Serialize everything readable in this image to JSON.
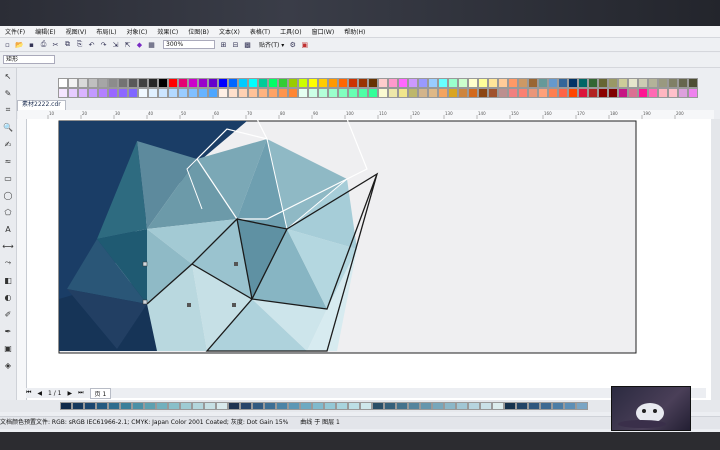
{
  "menu": [
    "文件(F)",
    "编辑(E)",
    "视图(V)",
    "布局(L)",
    "对象(C)",
    "效果(C)",
    "位图(B)",
    "文本(X)",
    "表格(T)",
    "工具(O)",
    "窗口(W)",
    "帮助(H)"
  ],
  "toolbar": {
    "zoom_value": "300%",
    "snap_label": "贴齐(T) ▾"
  },
  "property_bar": {
    "preset": "矩形"
  },
  "document_tab": {
    "label": "素材2222.cdr"
  },
  "ruler": {
    "marks": [
      "10",
      "20",
      "30",
      "40",
      "50",
      "60",
      "70",
      "80",
      "90",
      "100",
      "110",
      "120",
      "130",
      "140",
      "150",
      "160",
      "170",
      "180",
      "190",
      "200"
    ]
  },
  "page_bar": {
    "page_counter": "1 / 1",
    "page_tab": "页 1"
  },
  "status": {
    "text": "文档颜色预置文件: RGB: sRGB IEC61966-2.1; CMYK: Japan Color 2001 Coated; 灰度: Dot Gain 15%",
    "object_info": "曲线 于 图层 1"
  },
  "colors": {
    "palette": [
      "#ffffff",
      "#f2f2f2",
      "#d9d9d9",
      "#bfbfbf",
      "#a6a6a6",
      "#8c8c8c",
      "#737373",
      "#595959",
      "#404040",
      "#262626",
      "#000000",
      "#ff0000",
      "#e60073",
      "#cc00cc",
      "#9900cc",
      "#6600cc",
      "#0000ff",
      "#0066ff",
      "#00ccff",
      "#00ffff",
      "#00cc99",
      "#00ff66",
      "#33cc33",
      "#99cc00",
      "#ccff00",
      "#ffff00",
      "#ffcc00",
      "#ff9900",
      "#ff6600",
      "#cc3300",
      "#993300",
      "#663300",
      "#ffcccc",
      "#ff99cc",
      "#ff66ff",
      "#cc99ff",
      "#9999ff",
      "#99ccff",
      "#66ffff",
      "#99ffcc",
      "#ccffcc",
      "#ffffcc",
      "#ffff99",
      "#ffe699",
      "#ffcc99",
      "#ff9966",
      "#cc9966",
      "#996633",
      "#669999",
      "#6699cc",
      "#336699",
      "#003366",
      "#006666",
      "#336633",
      "#666633",
      "#999966",
      "#cccc99",
      "#e6e6cc",
      "#ccccb3",
      "#b3b399",
      "#999980",
      "#808066",
      "#66664d",
      "#4d4d33",
      "#f5e6ff",
      "#e6ccff",
      "#d9b3ff",
      "#c299ff",
      "#b380ff",
      "#9966ff",
      "#8c66ff",
      "#7f66ff",
      "#f0f8ff",
      "#e0f0ff",
      "#cce5ff",
      "#b3d9ff",
      "#99ccff",
      "#80bfff",
      "#66b3ff",
      "#4da6ff",
      "#fff0e6",
      "#ffe0cc",
      "#ffd1b3",
      "#ffc299",
      "#ffb380",
      "#ffa366",
      "#ff944d",
      "#ff8533",
      "#e6fff2",
      "#ccffe6",
      "#b3ffd9",
      "#99ffcc",
      "#80ffbf",
      "#66ffb3",
      "#4dffa6",
      "#33ff99",
      "#fafad2",
      "#eee8aa",
      "#f0e68c",
      "#bdb76b",
      "#d2b48c",
      "#deb887",
      "#f4a460",
      "#daa520",
      "#cd853f",
      "#d2691e",
      "#8b4513",
      "#a0522d",
      "#bc8f8f",
      "#f08080",
      "#fa8072",
      "#e9967a",
      "#ffa07a",
      "#ff7f50",
      "#ff6347",
      "#ff4500",
      "#dc143c",
      "#b22222",
      "#8b0000",
      "#800000",
      "#c71585",
      "#db7093",
      "#ff1493",
      "#ff69b4",
      "#ffb6c1",
      "#ffc0cb",
      "#dda0dd",
      "#ee82ee"
    ],
    "bottom_palette": [
      "#0f2a4a",
      "#15385c",
      "#1b466e",
      "#245a80",
      "#2e6d8e",
      "#3a7f9a",
      "#4b90a6",
      "#5ea0b0",
      "#72b0bd",
      "#88bfc9",
      "#9ecbd3",
      "#b3d6dc",
      "#c7e0e4",
      "#d8e9ec",
      "#1e3350",
      "#28456a",
      "#325a80",
      "#3e6f94",
      "#4c84a6",
      "#5c97b5",
      "#6daac2",
      "#80bacd",
      "#94c8d6",
      "#a8d4de",
      "#bcdfe6",
      "#cfe8ec",
      "#2a4e66",
      "#36607a",
      "#44728c",
      "#54849d",
      "#6596ad",
      "#78a7bb",
      "#8cb7c8",
      "#a1c6d4",
      "#b6d4df",
      "#cae1e8",
      "#dceced",
      "#16324d",
      "#224466",
      "#2f577d",
      "#3d6a92",
      "#4c7da5",
      "#5d8fb6",
      "#7aa5c4"
    ],
    "accent": "#3b6ea5"
  },
  "icons": [
    "pick-tool-icon",
    "shape-tool-icon",
    "crop-tool-icon",
    "zoom-tool-icon",
    "freehand-tool-icon",
    "smart-draw-icon",
    "rectangle-tool-icon",
    "ellipse-tool-icon",
    "polygon-tool-icon",
    "text-tool-icon",
    "parallel-dim-icon",
    "connector-icon",
    "interactive-fill-icon",
    "transparency-icon",
    "eyedropper-icon",
    "outline-pen-icon",
    "fill-icon",
    "smart-fill-icon"
  ]
}
